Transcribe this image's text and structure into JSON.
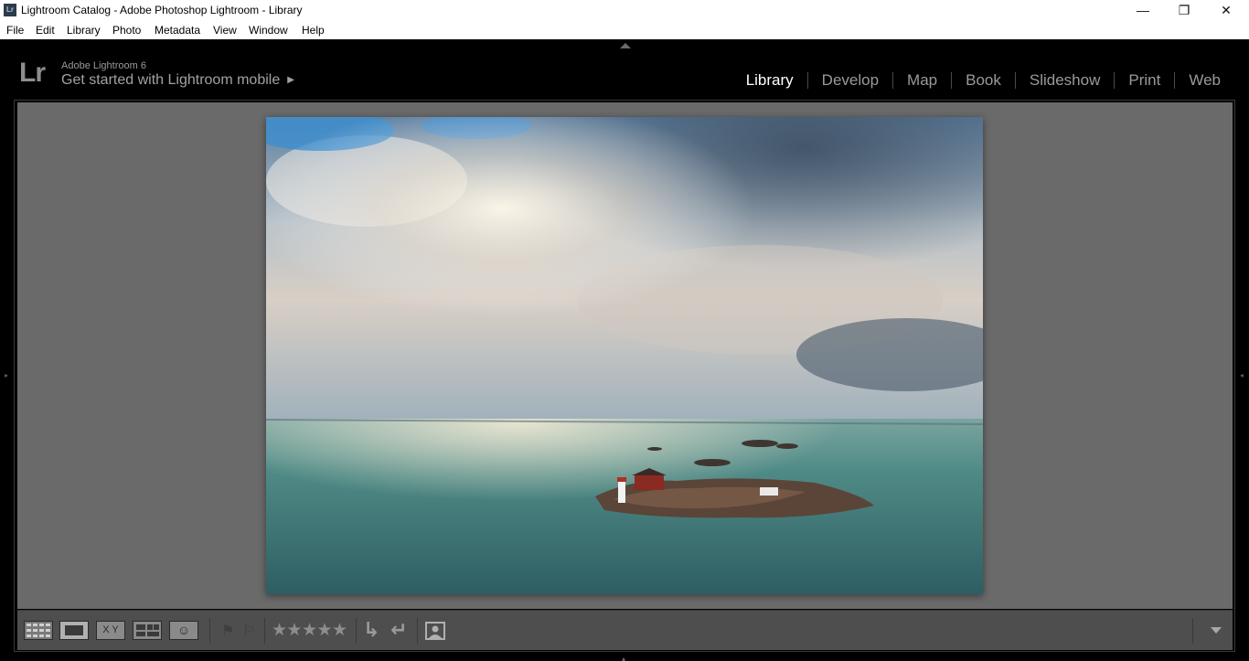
{
  "window": {
    "title": "Lightroom Catalog - Adobe Photoshop Lightroom - Library",
    "app_icon_text": "Lr",
    "minimize_glyph": "—",
    "maximize_glyph": "❐",
    "close_glyph": "✕"
  },
  "menubar": {
    "items": [
      "File",
      "Edit",
      "Library",
      "Photo",
      "Metadata",
      "View",
      "Window",
      "Help"
    ]
  },
  "identity": {
    "logo": "Lr",
    "version": "Adobe Lightroom 6",
    "mobile_prompt": "Get started with Lightroom mobile",
    "mobile_arrow": "▶"
  },
  "modules": {
    "items": [
      "Library",
      "Develop",
      "Map",
      "Book",
      "Slideshow",
      "Print",
      "Web"
    ],
    "active": "Library"
  },
  "toolbar": {
    "views": [
      "grid-view-icon",
      "loupe-view-icon",
      "compare-view-icon",
      "survey-view-icon",
      "people-view-icon"
    ],
    "active_view": "loupe-view-icon",
    "compare_label_x": "X",
    "compare_label_y": "Y",
    "rating_stars": "★★★★★",
    "rating_value": 0,
    "flag_glyph": "⚑",
    "reject_glyph": "⚐",
    "rotate_left_glyph": "↳",
    "rotate_right_glyph": "↵",
    "people_glyph": "☺"
  },
  "colors": {
    "background": "#000000",
    "canvas": "#6a6a6a",
    "toolbar": "#4e4e4e",
    "active_module": "#ffffff",
    "inactive_module": "#9a9a9a"
  }
}
